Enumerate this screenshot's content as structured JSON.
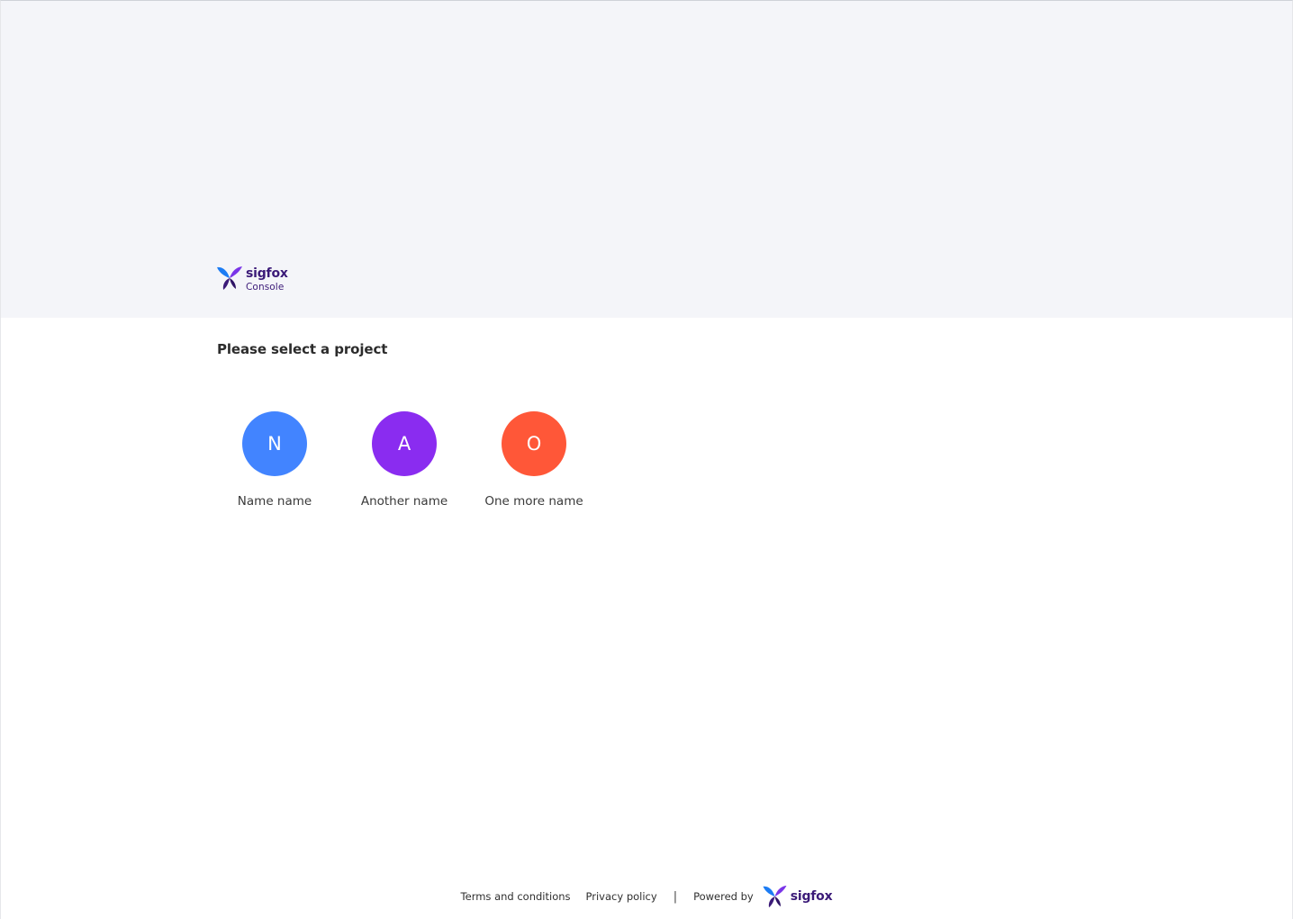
{
  "brand": {
    "name": "sigfox",
    "subtitle": "Console"
  },
  "main": {
    "title": "Please select a project",
    "projects": [
      {
        "initial": "N",
        "label": "Name name",
        "color": "#4284ff"
      },
      {
        "initial": "A",
        "label": "Another name",
        "color": "#8a2cf0"
      },
      {
        "initial": "O",
        "label": "One more name",
        "color": "#ff5738"
      }
    ]
  },
  "footer": {
    "terms": "Terms and conditions",
    "privacy": "Privacy policy",
    "separator": "|",
    "powered_by": "Powered by",
    "brand": "sigfox"
  },
  "colors": {
    "header_background": "#f4f5f9",
    "brand_purple": "#3b1a78",
    "brand_blue": "#1c7cf4"
  },
  "icons": {
    "brand_logo": "sigfox-butterfly-icon"
  }
}
